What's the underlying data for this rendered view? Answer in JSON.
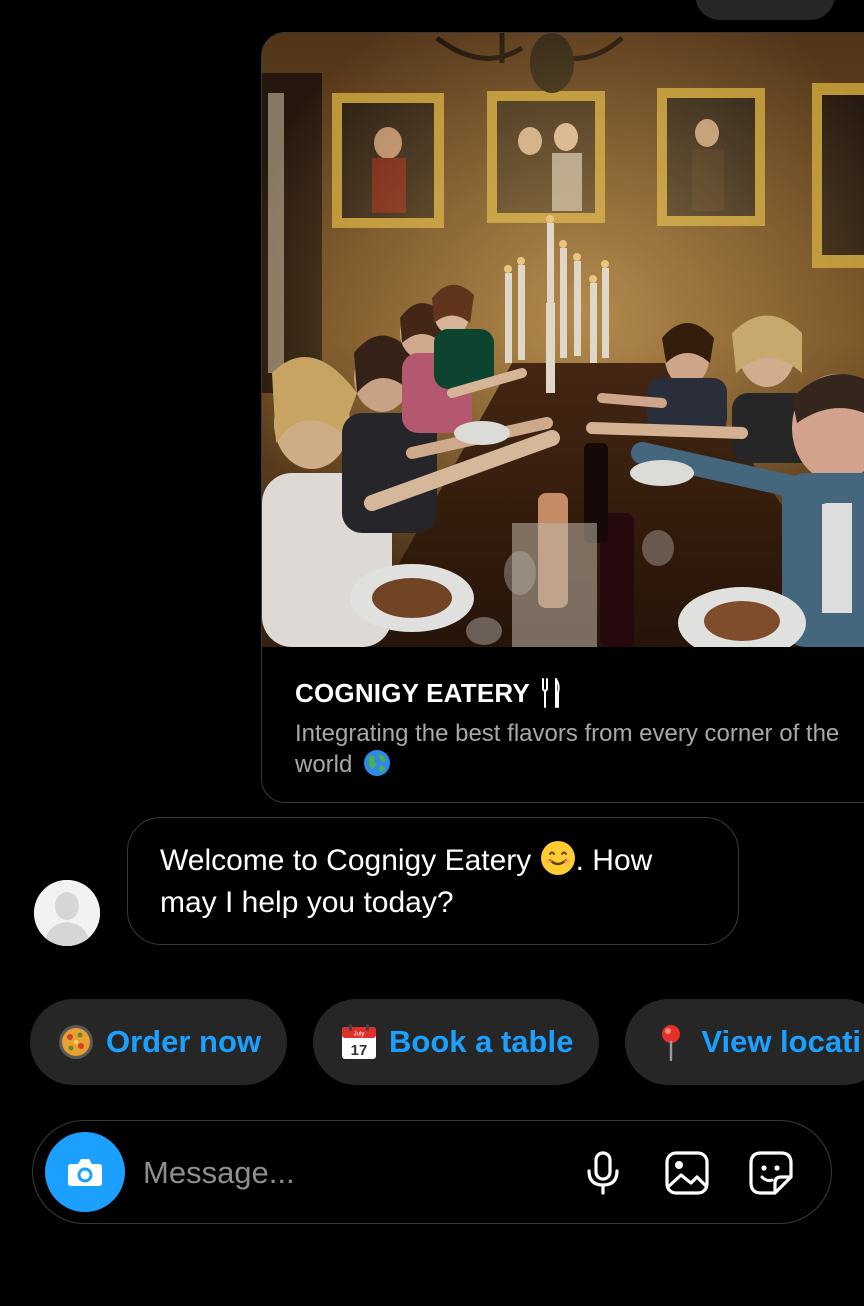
{
  "card": {
    "image_alt": "Group of diners toasting at a candlelit table in an ornate dining room",
    "title": "COGNIGY EATERY",
    "title_icon": "fork-knife-icon",
    "subtitle": "Integrating the best flavors from every corner of the world",
    "subtitle_icon": "globe-icon"
  },
  "message": {
    "avatar_icon": "default-user-avatar",
    "text_before_emoji": "Welcome to Cognigy Eatery",
    "emoji_icon": "smiling-face-icon",
    "text_after_emoji": ". How may I help you today?"
  },
  "quick_replies": [
    {
      "label": "Order now",
      "icon": "paella-pan-icon"
    },
    {
      "label": "Book a table",
      "icon": "calendar-icon"
    },
    {
      "label": "View locati",
      "icon": "location-pin-icon"
    }
  ],
  "composer": {
    "placeholder": "Message...",
    "camera_icon": "camera-icon",
    "mic_icon": "microphone-icon",
    "gallery_icon": "image-icon",
    "sticker_icon": "sticker-icon"
  },
  "colors": {
    "background": "#000000",
    "accent": "#1ba0ff",
    "chip_bg": "#262626",
    "border": "#3a3a3a",
    "muted_text": "#a8a8a8"
  }
}
